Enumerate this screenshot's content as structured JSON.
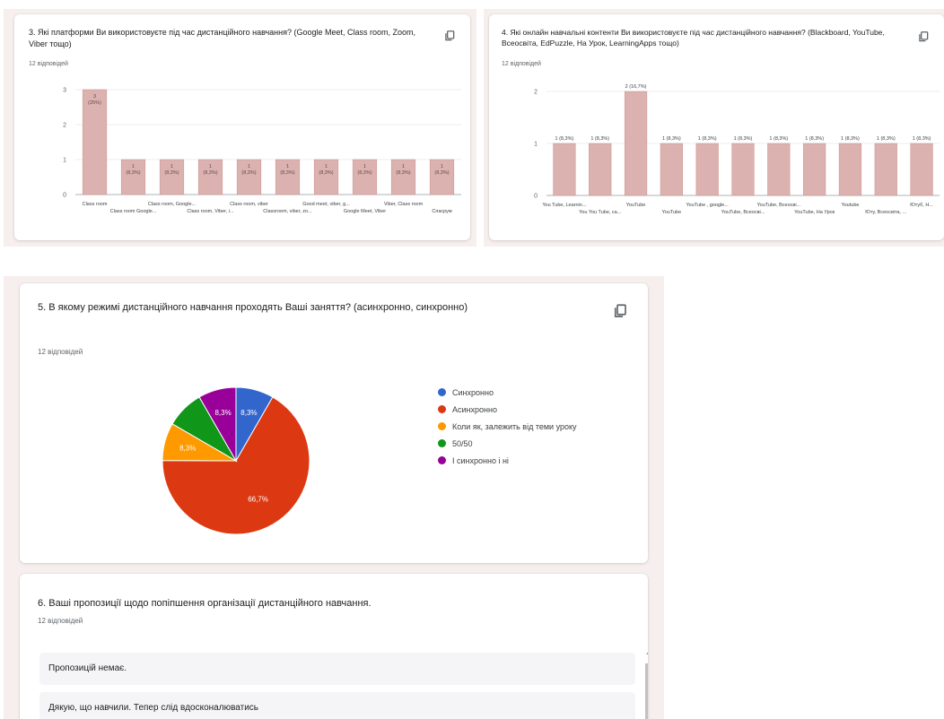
{
  "q3": {
    "title": "3. Які платформи Ви використовуєте під час дистанційного навчання? (Google Meet, Class room, Zoom, Viber тощо)",
    "count": "12 відповідей"
  },
  "q4": {
    "title": "4. Які онлайн навчальні контенти Ви використовуєте під час дистанційного навчання? (Blackboard, YouTube, Всеосвіта, EdPuzzle, На Урок, LearningApps тощо)",
    "count": "12 відповідей"
  },
  "q5": {
    "title": "5. В якому режимі дистанційного навчання проходять Ваші заняття? (асинхронно, синхронно)",
    "count": "12 відповідей"
  },
  "q6": {
    "title": "6. Ваші пропозиції щодо попіпшення організації дистанційного навчання.",
    "count": "12 відповідей",
    "responses": [
      "Пропозицій немає.",
      "Дякую, що навчили. Тепер слід вдосконалюватись"
    ]
  },
  "icons": {
    "copy": "copy-icon"
  },
  "colors": {
    "bar": "#dbb2af",
    "bar_border": "#c9928d",
    "card_bg": "#ffffff",
    "page_strip": "#f6efee"
  },
  "chart_data": [
    {
      "type": "bar",
      "categories": [
        "Class room",
        "Class room Google...",
        "Class room, Google...",
        "Class room, Viber, і...",
        "Class room, viber",
        "Classroom, viber, zo...",
        "Good meet, viber, g...",
        "Google Meet, Viber",
        "Viber, Class room",
        "Спасрум"
      ],
      "values": [
        3,
        1,
        1,
        1,
        1,
        1,
        1,
        1,
        1,
        1
      ],
      "data_labels": [
        [
          "3",
          "(25%)"
        ],
        [
          "1",
          "(8,3%)"
        ],
        [
          "1",
          "(8,3%)"
        ],
        [
          "1",
          "(8,3%)"
        ],
        [
          "1",
          "(8,3%)"
        ],
        [
          "1",
          "(8,3%)"
        ],
        [
          "1",
          "(8,3%)"
        ],
        [
          "1",
          "(8,3%)"
        ],
        [
          "1",
          "(8,3%)"
        ],
        [
          "1",
          "(8,3%)"
        ]
      ],
      "ylim": [
        0,
        3
      ],
      "yticks": [
        "0",
        "1",
        "2",
        "3"
      ],
      "grid": true
    },
    {
      "type": "bar",
      "categories": [
        "You Tube, Learnin...",
        "You You Tube, са...",
        "YouTube",
        "YouTube",
        "YouTube , google...",
        "YouTube, Всеосві...",
        "YouTube, Всеосві...",
        "YouTube, На Урок",
        "Youtube",
        "Юту, Всеосвіта, ...",
        "Ютуб, Н..."
      ],
      "values": [
        1,
        1,
        2,
        1,
        1,
        1,
        1,
        1,
        1,
        1,
        1
      ],
      "data_labels": [
        "1 (8,3%)",
        "1 (8,3%)",
        "2 (16,7%)",
        "1 (8,3%)",
        "1 (8,3%)",
        "1 (8,3%)",
        "1 (8,3%)",
        "1 (8,3%)",
        "1 (8,3%)",
        "1 (8,3%)",
        "1 (8,3%)"
      ],
      "ylim": [
        0,
        2
      ],
      "yticks": [
        "0",
        "1",
        "2"
      ],
      "grid": true
    },
    {
      "type": "pie",
      "slices": [
        {
          "label": "Синхронно",
          "value": 8.3,
          "data_label": "8,3%",
          "color": "#3366cc"
        },
        {
          "label": "Асинхронно",
          "value": 66.7,
          "data_label": "66,7%",
          "color": "#dc3912"
        },
        {
          "label": "Коли як, залежить від теми уроку",
          "value": 8.3,
          "data_label": "8,3%",
          "color": "#ff9900"
        },
        {
          "label": "50/50",
          "value": 8.3,
          "data_label": "",
          "color": "#109618"
        },
        {
          "label": "І синхронно і ні",
          "value": 8.3,
          "data_label": "8,3%",
          "color": "#990099"
        }
      ],
      "legend": "right"
    }
  ]
}
